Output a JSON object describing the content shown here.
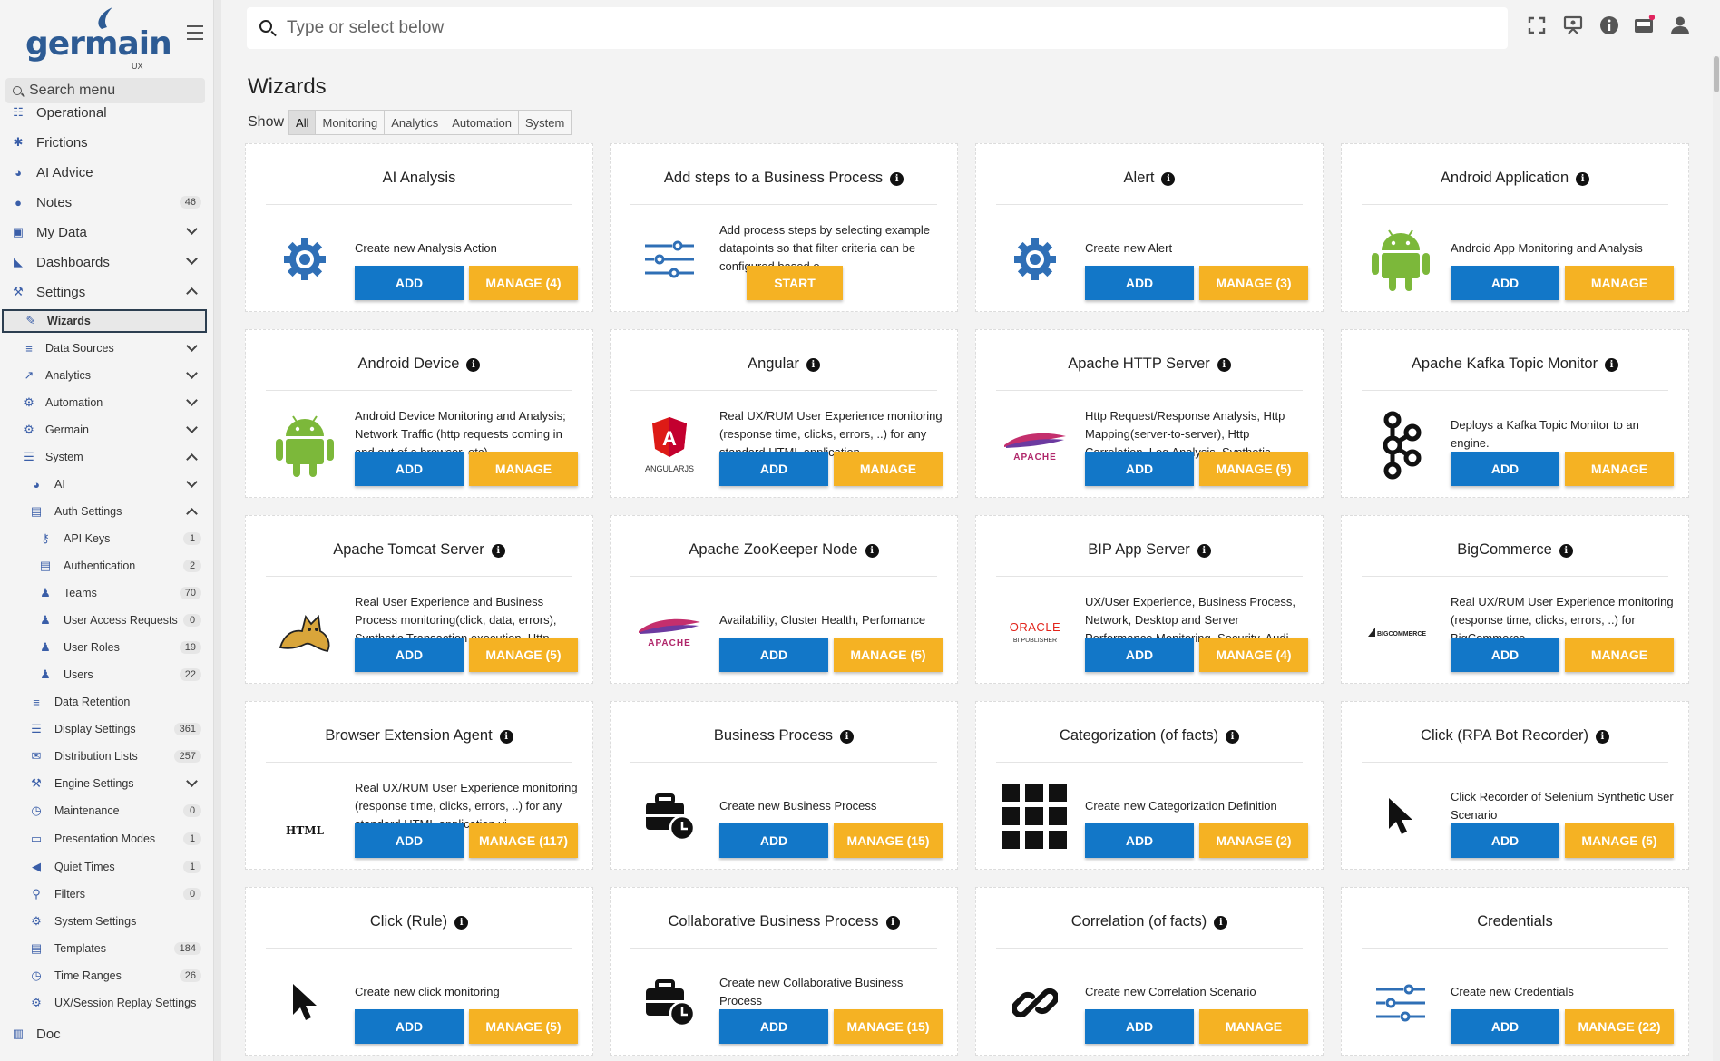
{
  "app": {
    "logo_text": "germain",
    "logo_sub": "UX"
  },
  "sidebar": {
    "search_placeholder": "Search menu",
    "items": [
      {
        "label": "Operational",
        "icon": "sitemap-icon",
        "level": 0
      },
      {
        "label": "Frictions",
        "icon": "frictions-icon",
        "level": 0
      },
      {
        "label": "AI Advice",
        "icon": "brain-icon",
        "level": 0
      },
      {
        "label": "Notes",
        "icon": "comment-icon",
        "level": 0,
        "badge": "46"
      },
      {
        "label": "My Data",
        "icon": "save-icon",
        "level": 0,
        "chevron": "down"
      },
      {
        "label": "Dashboards",
        "icon": "chart-area-icon",
        "level": 0,
        "chevron": "down"
      },
      {
        "label": "Settings",
        "icon": "tools-icon",
        "level": 0,
        "chevron": "up"
      },
      {
        "label": "Wizards",
        "icon": "wand-icon",
        "level": 1,
        "active": true
      },
      {
        "label": "Data Sources",
        "icon": "database-icon",
        "level": 1,
        "chevron": "down"
      },
      {
        "label": "Analytics",
        "icon": "chart-line-icon",
        "level": 1,
        "chevron": "down"
      },
      {
        "label": "Automation",
        "icon": "robot-icon",
        "level": 1,
        "chevron": "down"
      },
      {
        "label": "Germain",
        "icon": "cogs-icon",
        "level": 1,
        "chevron": "down"
      },
      {
        "label": "System",
        "icon": "server-icon",
        "level": 1,
        "chevron": "up"
      },
      {
        "label": "AI",
        "icon": "brain-icon",
        "level": 2,
        "chevron": "down"
      },
      {
        "label": "Auth Settings",
        "icon": "id-card-icon",
        "level": 2,
        "chevron": "up"
      },
      {
        "label": "API Keys",
        "icon": "key-icon",
        "level": 3,
        "badge": "1"
      },
      {
        "label": "Authentication",
        "icon": "id-card-icon",
        "level": 3,
        "badge": "2"
      },
      {
        "label": "Teams",
        "icon": "users-icon",
        "level": 3,
        "badge": "70"
      },
      {
        "label": "User Access Requests",
        "icon": "user-plus-icon",
        "level": 3,
        "badge": "0"
      },
      {
        "label": "User Roles",
        "icon": "users-cog-icon",
        "level": 3,
        "badge": "19"
      },
      {
        "label": "Users",
        "icon": "user-icon",
        "level": 3,
        "badge": "22"
      },
      {
        "label": "Data Retention",
        "icon": "database-icon",
        "level": 2
      },
      {
        "label": "Display Settings",
        "icon": "list-icon",
        "level": 2,
        "badge": "361"
      },
      {
        "label": "Distribution Lists",
        "icon": "mail-bulk-icon",
        "level": 2,
        "badge": "257"
      },
      {
        "label": "Engine Settings",
        "icon": "wrench-icon",
        "level": 2,
        "chevron": "down"
      },
      {
        "label": "Maintenance",
        "icon": "stopwatch-icon",
        "level": 2,
        "badge": "0"
      },
      {
        "label": "Presentation Modes",
        "icon": "desktop-icon",
        "level": 2,
        "badge": "1"
      },
      {
        "label": "Quiet Times",
        "icon": "volume-mute-icon",
        "level": 2,
        "badge": "1"
      },
      {
        "label": "Filters",
        "icon": "search-icon",
        "level": 2,
        "badge": "0"
      },
      {
        "label": "System Settings",
        "icon": "cog-icon",
        "level": 2
      },
      {
        "label": "Templates",
        "icon": "list-alt-icon",
        "level": 2,
        "badge": "184"
      },
      {
        "label": "Time Ranges",
        "icon": "clock-icon",
        "level": 2,
        "badge": "26"
      },
      {
        "label": "UX/Session Replay Settings",
        "icon": "cog-icon",
        "level": 2
      },
      {
        "label": "Doc",
        "icon": "book-icon",
        "level": 0
      }
    ]
  },
  "topbar": {
    "search_placeholder": "Type or select below",
    "icons": [
      "expand-icon",
      "chalkboard-user-icon",
      "info-circle-icon",
      "inbox-icon",
      "user-icon"
    ]
  },
  "page": {
    "title": "Wizards",
    "show_label": "Show",
    "filters": [
      "All",
      "Monitoring",
      "Analytics",
      "Automation",
      "System"
    ],
    "active_filter": "All"
  },
  "cards": [
    {
      "title": "AI Analysis",
      "info": false,
      "icon": "gear-icon",
      "desc": "Create new Analysis Action",
      "buttons": [
        "ADD",
        "MANAGE (4)"
      ]
    },
    {
      "title": "Add steps to a Business Process",
      "info": true,
      "icon": "sliders-icon",
      "desc": "Add process steps by selecting example datapoints so that filter criteria can be configured based o...",
      "buttons": [
        "START"
      ]
    },
    {
      "title": "Alert",
      "info": true,
      "icon": "gear-icon",
      "desc": "Create new Alert",
      "buttons": [
        "ADD",
        "MANAGE (3)"
      ]
    },
    {
      "title": "Android Application",
      "info": true,
      "icon": "android-icon",
      "desc": "Android App Monitoring and Analysis",
      "buttons": [
        "ADD",
        "MANAGE"
      ]
    },
    {
      "title": "Android Device",
      "info": true,
      "icon": "android-icon",
      "desc": "Android Device Monitoring and Analysis; Network Traffic (http requests coming in and out of a browser, etc)",
      "buttons": [
        "ADD",
        "MANAGE"
      ]
    },
    {
      "title": "Angular",
      "info": true,
      "icon": "angular-icon",
      "icon_text": "ANGULARJS",
      "desc": "Real UX/RUM User Experience monitoring (response time, clicks, errors, ..) for any standard HTML application...",
      "buttons": [
        "ADD",
        "MANAGE"
      ]
    },
    {
      "title": "Apache HTTP Server",
      "info": true,
      "icon": "apache-feather-icon",
      "icon_text": "APACHE",
      "desc": "Http Request/Response Analysis, Http Mapping(server-to-server), Http Correlation, Log Analysis, Synthetic...",
      "buttons": [
        "ADD",
        "MANAGE (5)"
      ]
    },
    {
      "title": "Apache Kafka Topic Monitor",
      "info": true,
      "icon": "kafka-icon",
      "desc": "Deploys a Kafka Topic Monitor to an engine.",
      "buttons": [
        "ADD",
        "MANAGE"
      ]
    },
    {
      "title": "Apache Tomcat Server",
      "info": true,
      "icon": "tomcat-icon",
      "desc": "Real User Experience and Business Process monitoring(click, data, errors), Synthetic Transaction execution, Http...",
      "buttons": [
        "ADD",
        "MANAGE (5)"
      ]
    },
    {
      "title": "Apache ZooKeeper Node",
      "info": true,
      "icon": "apache-feather-icon",
      "icon_text": "APACHE",
      "desc": "Availability, Cluster Health, Perfomance",
      "buttons": [
        "ADD",
        "MANAGE (5)"
      ]
    },
    {
      "title": "BIP App Server",
      "info": true,
      "icon": "oracle-logo-icon",
      "icon_text": "ORACLE",
      "icon_sub": "BI PUBLISHER",
      "desc": "UX/User Experience, Business Process, Network, Desktop and Server Performance Monitoring, Security, Audi...",
      "buttons": [
        "ADD",
        "MANAGE (4)"
      ]
    },
    {
      "title": "BigCommerce",
      "info": true,
      "icon": "bigcommerce-logo-icon",
      "icon_text": "BIGCOMMERCE",
      "desc": "Real UX/RUM User Experience monitoring (response time, clicks, errors, ..) for BigCommerce",
      "buttons": [
        "ADD",
        "MANAGE"
      ]
    },
    {
      "title": "Browser Extension Agent",
      "info": true,
      "icon": "html-code-icon",
      "icon_text": "</>",
      "icon_sub": "HTML",
      "desc": "Real UX/RUM User Experience monitoring (response time, clicks, errors, ..) for any standard HTML application vi...",
      "buttons": [
        "ADD",
        "MANAGE (117)"
      ]
    },
    {
      "title": "Business Process",
      "info": true,
      "icon": "briefcase-clock-icon",
      "desc": "Create new Business Process",
      "buttons": [
        "ADD",
        "MANAGE (15)"
      ]
    },
    {
      "title": "Categorization (of facts)",
      "info": true,
      "icon": "grid-icon",
      "desc": "Create new Categorization Definition",
      "buttons": [
        "ADD",
        "MANAGE (2)"
      ]
    },
    {
      "title": "Click (RPA Bot Recorder)",
      "info": true,
      "icon": "mouse-pointer-icon",
      "desc": "Click Recorder of Selenium Synthetic User Scenario",
      "buttons": [
        "ADD",
        "MANAGE (5)"
      ]
    },
    {
      "title": "Click (Rule)",
      "info": true,
      "icon": "mouse-pointer-icon",
      "desc": "Create new click monitoring",
      "buttons": [
        "ADD",
        "MANAGE (5)"
      ]
    },
    {
      "title": "Collaborative Business Process",
      "info": true,
      "icon": "briefcase-clock-icon",
      "desc": "Create new Collaborative Business Process",
      "buttons": [
        "ADD",
        "MANAGE (15)"
      ]
    },
    {
      "title": "Correlation (of facts)",
      "info": true,
      "icon": "link-icon",
      "desc": "Create new Correlation Scenario",
      "buttons": [
        "ADD",
        "MANAGE"
      ]
    },
    {
      "title": "Credentials",
      "info": false,
      "icon": "sliders-icon",
      "desc": "Create new Credentials",
      "buttons": [
        "ADD",
        "MANAGE (22)"
      ]
    }
  ],
  "colors": {
    "add": "#1277c8",
    "manage": "#f5b223",
    "brand": "#2d5b94",
    "android": "#7cb83a",
    "angular": "#dd1b16"
  }
}
